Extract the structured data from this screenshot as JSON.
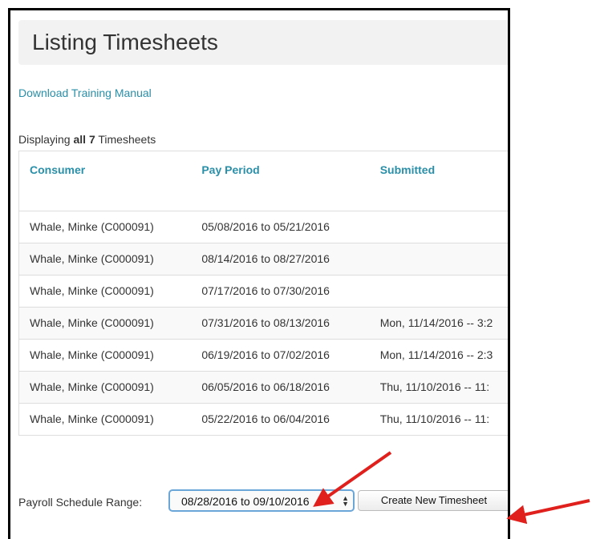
{
  "page": {
    "title": "Listing Timesheets",
    "manual_link": "Download Training Manual",
    "displaying_prefix": "Displaying ",
    "displaying_bold": "all 7",
    "displaying_suffix": " Timesheets"
  },
  "table": {
    "columns": [
      "Consumer",
      "Pay Period",
      "Submitted"
    ],
    "rows": [
      {
        "consumer": "Whale, Minke (C000091)",
        "pay_period": "05/08/2016 to 05/21/2016",
        "submitted": ""
      },
      {
        "consumer": "Whale, Minke (C000091)",
        "pay_period": "08/14/2016 to 08/27/2016",
        "submitted": ""
      },
      {
        "consumer": "Whale, Minke (C000091)",
        "pay_period": "07/17/2016 to 07/30/2016",
        "submitted": ""
      },
      {
        "consumer": "Whale, Minke (C000091)",
        "pay_period": "07/31/2016 to 08/13/2016",
        "submitted": "Mon, 11/14/2016 -- 3:2"
      },
      {
        "consumer": "Whale, Minke (C000091)",
        "pay_period": "06/19/2016 to 07/02/2016",
        "submitted": "Mon, 11/14/2016 -- 2:3"
      },
      {
        "consumer": "Whale, Minke (C000091)",
        "pay_period": "06/05/2016 to 06/18/2016",
        "submitted": "Thu, 11/10/2016 -- 11:"
      },
      {
        "consumer": "Whale, Minke (C000091)",
        "pay_period": "05/22/2016 to 06/04/2016",
        "submitted": "Thu, 11/10/2016 -- 11:"
      }
    ]
  },
  "footer": {
    "payroll_label": "Payroll Schedule Range:",
    "payroll_selected": "08/28/2016 to 09/10/2016",
    "create_button": "Create New Timesheet"
  },
  "colors": {
    "link": "#2a8fa8",
    "annotation_arrow": "#e0201c",
    "select_focus": "#6aa6d8"
  }
}
